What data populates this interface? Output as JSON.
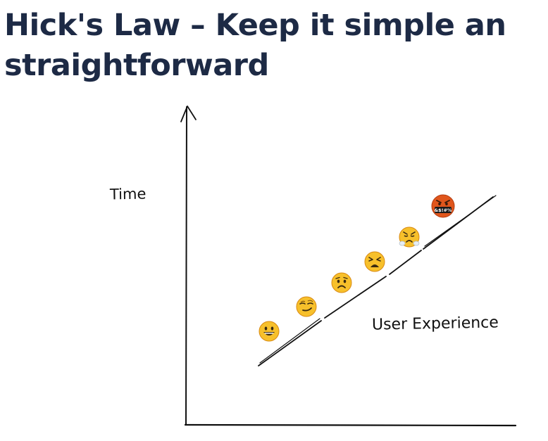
{
  "title": {
    "line1": "Hick's Law – Keep it simple an",
    "line2": "straightforward"
  },
  "diagram": {
    "y_axis_label": "Time",
    "trend_label": "User Experience",
    "angry_face_text": "&$!#%"
  },
  "colors": {
    "title": "#1d2a45",
    "ink": "#111111",
    "emoji_yellow": "#f7c02b",
    "emoji_outline": "#d98a12",
    "emoji_angry": "#e0561c"
  },
  "emojis": [
    {
      "name": "grinning-face-icon"
    },
    {
      "name": "smirking-face-icon"
    },
    {
      "name": "worried-face-icon"
    },
    {
      "name": "tired-face-icon"
    },
    {
      "name": "steaming-face-icon"
    },
    {
      "name": "cursing-face-icon"
    }
  ]
}
